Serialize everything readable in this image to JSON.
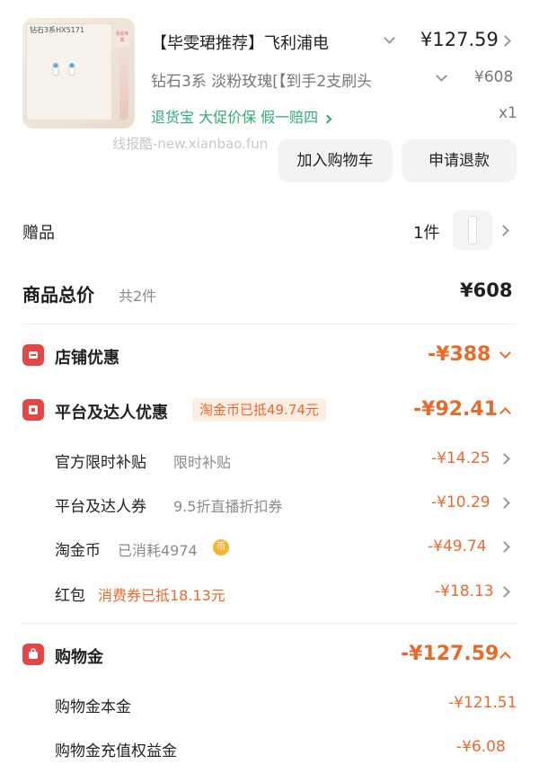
{
  "product": {
    "title": "【毕雯珺推荐】飞利浦电",
    "price": "¥127.59",
    "variant": "钻石3系 淡粉玫瑰[【到手2支刷头",
    "original_price": "¥608",
    "services": "退货宝 大促价保 假一赔四",
    "quantity": "x1",
    "thumb_brand": "钻石3系HX5171",
    "thumb_badge": "活动专享"
  },
  "watermark": "线报酷-new.xianbao.fun",
  "actions": {
    "add_cart": "加入购物车",
    "refund": "申请退款"
  },
  "gift": {
    "label": "赠品",
    "count": "1件"
  },
  "total": {
    "label": "商品总价",
    "count": "共2件",
    "value": "¥608"
  },
  "shop_discount": {
    "label": "店铺优惠",
    "value": "-¥388"
  },
  "platform_discount": {
    "label": "平台及达人优惠",
    "tag": "淘金币已抵49.74元",
    "value": "-¥92.41",
    "items": [
      {
        "label": "官方限时补贴",
        "note": "限时补贴",
        "value": "-¥14.25"
      },
      {
        "label": "平台及达人券",
        "note": "9.5折直播折扣券",
        "value": "-¥10.29"
      },
      {
        "label": "淘金币",
        "note": "已消耗4974",
        "value": "-¥49.74"
      },
      {
        "label": "红包",
        "note": "消费券已抵18.13元",
        "value": "-¥18.13"
      }
    ]
  },
  "shopping_money": {
    "label": "购物金",
    "value": "-¥127.59",
    "items": [
      {
        "label": "购物金本金",
        "value": "-¥121.51"
      },
      {
        "label": "购物金充值权益金",
        "value": "-¥6.08"
      }
    ]
  },
  "colors": {
    "accent": "#e86a2b",
    "red_icon": "#e64545",
    "green": "#2bae72"
  }
}
